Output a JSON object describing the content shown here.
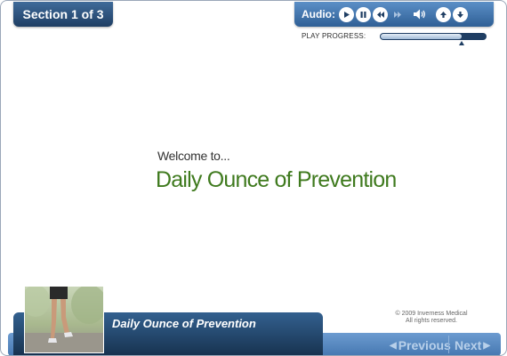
{
  "header": {
    "section_label": "Section 1 of 3"
  },
  "audio": {
    "label": "Audio:",
    "controls": [
      {
        "name": "play",
        "icon": "play-icon"
      },
      {
        "name": "pause",
        "icon": "pause-icon"
      },
      {
        "name": "rewind",
        "icon": "rewind-icon"
      },
      {
        "name": "fast-forward",
        "icon": "fast-forward-icon",
        "disabled": true
      }
    ],
    "volume_icon": "speaker-icon",
    "volume_up_icon": "up-arrow-icon",
    "volume_down_icon": "down-arrow-icon"
  },
  "progress": {
    "label": "PLAY PROGRESS:",
    "value": 0.77
  },
  "content": {
    "welcome": "Welcome to...",
    "title": "Daily Ounce of Prevention"
  },
  "footer": {
    "course_title": "Daily Ounce of Prevention",
    "copyright_line1": "© 2009 Inverness Medical",
    "copyright_line2": "All rights reserved.",
    "previous_label": "Previous",
    "next_label": "Next"
  },
  "colors": {
    "accent_blue": "#2f5f95",
    "dark_blue": "#1f3e63",
    "title_green": "#3f7a1e"
  }
}
